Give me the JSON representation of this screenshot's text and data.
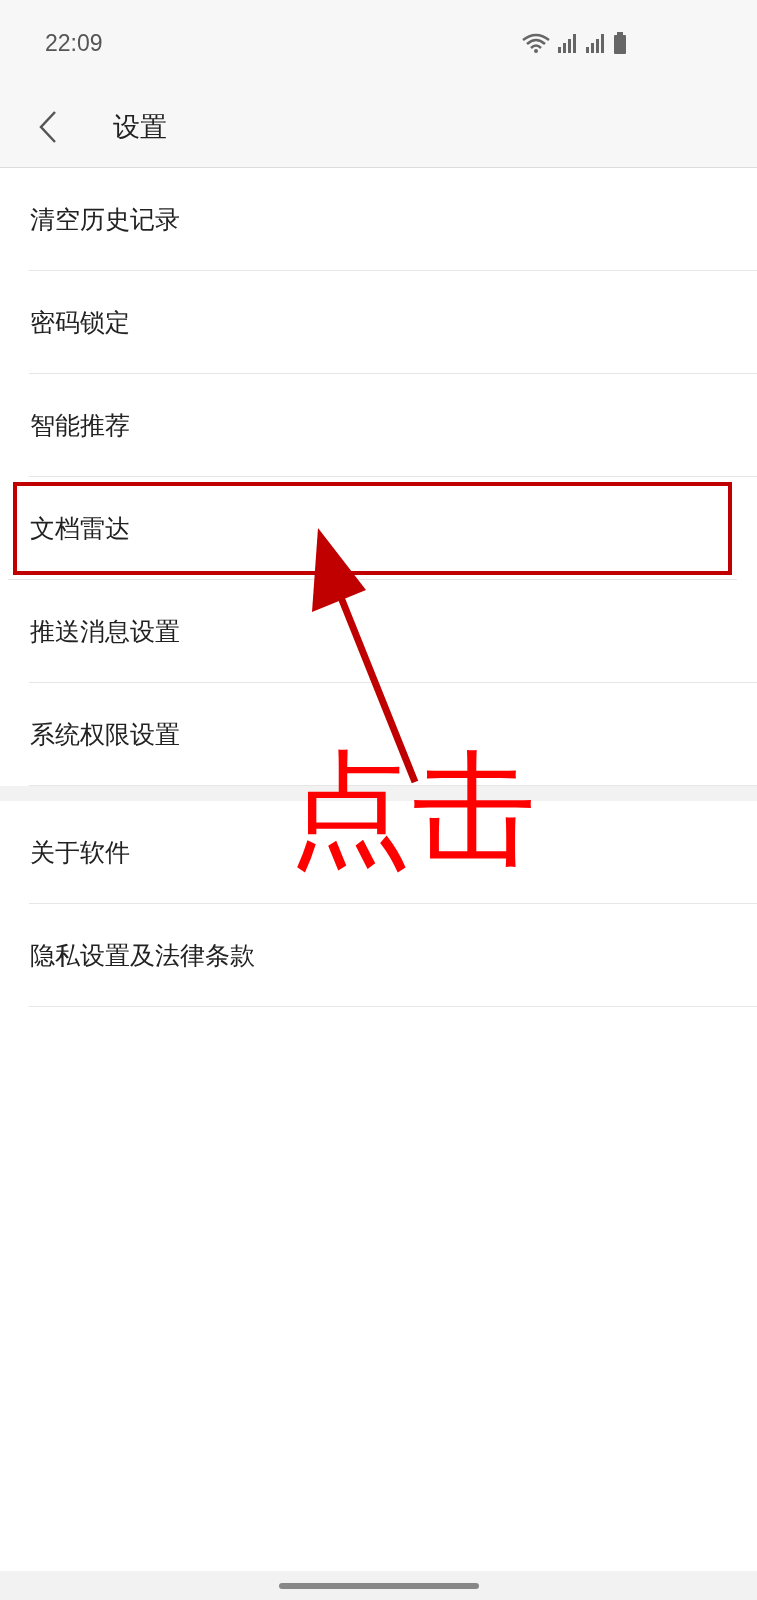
{
  "status_bar": {
    "time": "22:09"
  },
  "header": {
    "title": "设置"
  },
  "sections": [
    {
      "items": [
        {
          "label": "清空历史记录",
          "highlighted": false
        },
        {
          "label": "密码锁定",
          "highlighted": false
        },
        {
          "label": "智能推荐",
          "highlighted": false
        },
        {
          "label": "文档雷达",
          "highlighted": true
        },
        {
          "label": "推送消息设置",
          "highlighted": false
        },
        {
          "label": "系统权限设置",
          "highlighted": false
        }
      ]
    },
    {
      "items": [
        {
          "label": "关于软件",
          "highlighted": false
        },
        {
          "label": "隐私设置及法律条款",
          "highlighted": false
        }
      ]
    }
  ],
  "annotation": {
    "text": "点击"
  }
}
